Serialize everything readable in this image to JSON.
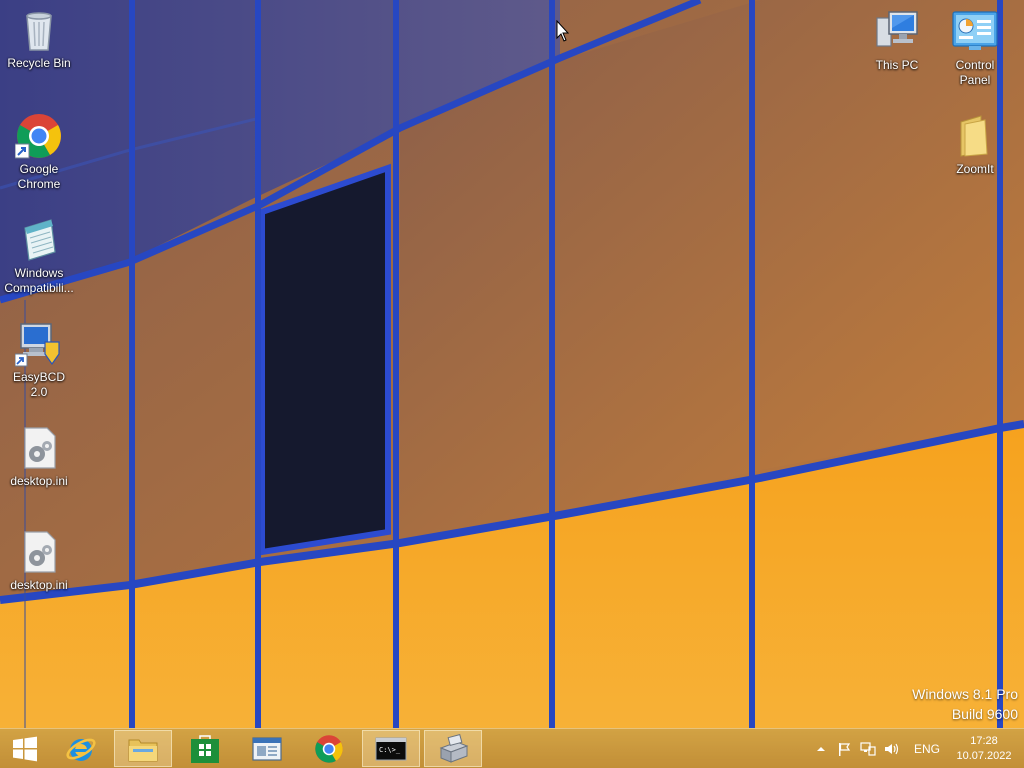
{
  "desktop": {
    "left_icons": [
      {
        "label": "Recycle Bin",
        "icon": "recycle-bin-icon"
      },
      {
        "label": "Google Chrome",
        "icon": "chrome-icon"
      },
      {
        "label": "Windows Compatibili...",
        "icon": "notepad-icon"
      },
      {
        "label": "EasyBCD 2.0",
        "icon": "easybcd-icon"
      },
      {
        "label": "desktop.ini",
        "icon": "settings-file-icon"
      },
      {
        "label": "desktop.ini",
        "icon": "settings-file-icon"
      }
    ],
    "right_icons": [
      {
        "label": "This PC",
        "icon": "computer-icon"
      },
      {
        "label": "Control Panel",
        "icon": "control-panel-icon"
      },
      {
        "label": "ZoomIt",
        "icon": "folder-icon"
      }
    ]
  },
  "watermark": {
    "line1": "Windows 8.1 Pro",
    "line2": "Build 9600"
  },
  "taskbar": {
    "buttons": [
      {
        "name": "start",
        "icon": "windows-logo-icon"
      },
      {
        "name": "internet-explorer",
        "icon": "ie-icon"
      },
      {
        "name": "file-explorer",
        "icon": "folder-icon",
        "active": true
      },
      {
        "name": "store",
        "icon": "store-icon"
      },
      {
        "name": "app",
        "icon": "window-icon"
      },
      {
        "name": "chrome",
        "icon": "chrome-icon"
      },
      {
        "name": "command-prompt",
        "icon": "cmd-icon",
        "active": true
      },
      {
        "name": "setup",
        "icon": "installer-icon",
        "active": true
      }
    ],
    "tray": {
      "language": "ENG",
      "time": "17:28",
      "date": "10.07.2022"
    }
  },
  "colors": {
    "taskbar": "#c8963f",
    "wallpaper_orange": "#f5a623",
    "wallpaper_frame": "#2b49b8"
  }
}
